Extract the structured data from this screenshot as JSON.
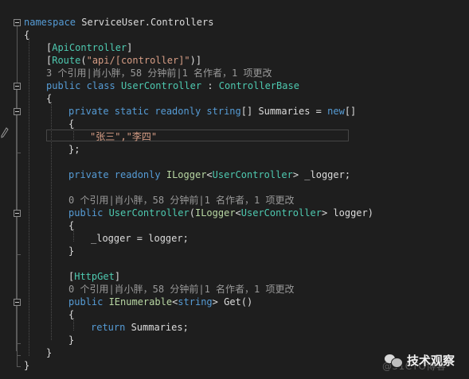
{
  "colors": {
    "background": "#1e1e1e",
    "default": "#dcdcdc",
    "keyword": "#569cd6",
    "type": "#4ec9b0",
    "interface": "#b8d7a3",
    "string": "#d69d85",
    "lens": "#999999",
    "guide": "#4e4e4e"
  },
  "icons": [
    "pencil-edit-hint-icon",
    "fold-toggle-icon",
    "wechat-logo-icon"
  ],
  "lens": {
    "refs3": "3 个引用|肖小胖，58 分钟前|1 名作者，1 项更改",
    "refs0_ctor": "0 个引用|肖小胖，58 分钟前|1 名作者，1 项更改",
    "refs0_get": "0 个引用|肖小胖，58 分钟前|1 名作者，1 项更改"
  },
  "code": {
    "namespace_kw": "namespace",
    "namespace_name": " ServiceUser.Controllers",
    "brace_open": "{",
    "brace_close": "}",
    "brace_close_semi": "};",
    "attr_open": "[",
    "attr_close": "]",
    "attr_apicontroller": "ApiController",
    "attr_route": "Route",
    "route_paren_open": "(",
    "route_string": "\"api/[controller]\"",
    "route_paren_close": ")]",
    "kw_public": "public",
    "kw_class": " class ",
    "class_name": "UserController",
    "colon": " : ",
    "base_class": "ControllerBase",
    "kw_private": "private",
    "kw_static": " static",
    "kw_readonly": " readonly",
    "kw_string": " string",
    "summaries_decl": "[] Summaries = ",
    "kw_new": "new",
    "new_brackets": "[]",
    "array_values": "\"张三\",\"李四\"",
    "logger_space": " ",
    "ilogger": "ILogger",
    "lt": "<",
    "gt": ">",
    "logger_field": " _logger;",
    "ctor_name": " UserController",
    "paren_open": "(",
    "ctor_param": " logger)",
    "assign": "_logger = logger;",
    "httpget": "HttpGet",
    "ienumerable": " IEnumerable",
    "kw_string2": "string",
    "get_method": " Get()",
    "kw_return": "return",
    "return_val": " Summaries;"
  },
  "watermark": {
    "title": "技术观察",
    "sub": "@51CTO博客"
  }
}
